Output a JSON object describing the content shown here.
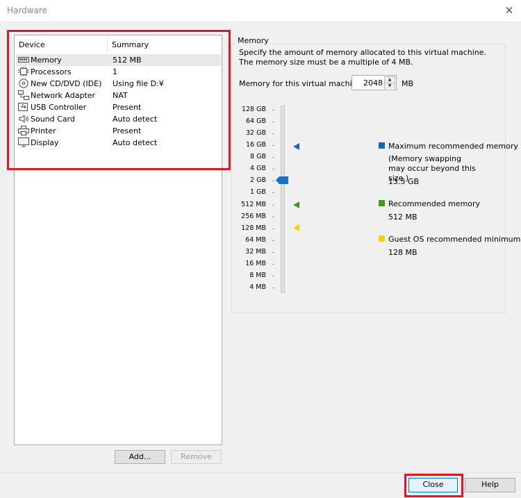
{
  "window": {
    "title": "Hardware"
  },
  "devices": {
    "columns": {
      "device": "Device",
      "summary": "Summary"
    },
    "rows": [
      {
        "name": "Memory",
        "summary": "512 MB",
        "icon": "memory-icon",
        "selected": true
      },
      {
        "name": "Processors",
        "summary": "1",
        "icon": "processor-icon"
      },
      {
        "name": "New CD/DVD (IDE)",
        "summary": "Using file D:¥",
        "icon": "cd-dvd-icon"
      },
      {
        "name": "Network Adapter",
        "summary": "NAT",
        "icon": "network-icon"
      },
      {
        "name": "USB Controller",
        "summary": "Present",
        "icon": "usb-icon"
      },
      {
        "name": "Sound Card",
        "summary": "Auto detect",
        "icon": "speaker-icon"
      },
      {
        "name": "Printer",
        "summary": "Present",
        "icon": "printer-icon"
      },
      {
        "name": "Display",
        "summary": "Auto detect",
        "icon": "monitor-icon"
      }
    ],
    "add_label": "Add...",
    "remove_label": "Remove"
  },
  "memory": {
    "group_title": "Memory",
    "description": "Specify the amount of memory allocated to this virtual machine. The memory size must be a multiple of 4 MB.",
    "field_label": "Memory for this virtual machine:",
    "value": "2048",
    "unit": "MB",
    "scale": [
      "128 GB",
      "64 GB",
      "32 GB",
      "16 GB",
      "8 GB",
      "4 GB",
      "2 GB",
      "1 GB",
      "512 MB",
      "256 MB",
      "128 MB",
      "64 MB",
      "32 MB",
      "16 MB",
      "8 MB",
      "4 MB"
    ],
    "slider_value": "2 GB",
    "legend": {
      "max": {
        "title": "Maximum recommended memory",
        "note": "(Memory swapping may occur beyond this size.)",
        "value": "13.5 GB",
        "color": "#1c64b6",
        "level": "16 GB"
      },
      "recommended": {
        "title": "Recommended memory",
        "value": "512 MB",
        "color": "#3f9a22",
        "level": "512 MB"
      },
      "minimum": {
        "title": "Guest OS recommended minimum",
        "value": "128 MB",
        "color": "#f2d400",
        "level": "128 MB"
      }
    }
  },
  "buttons": {
    "close": "Close",
    "help": "Help"
  },
  "highlight_color": "#e0171f"
}
